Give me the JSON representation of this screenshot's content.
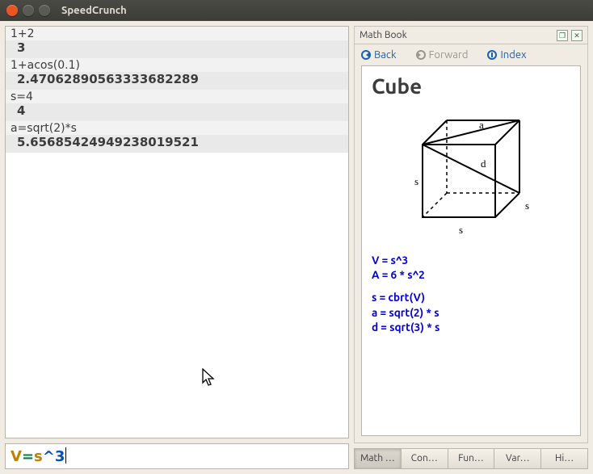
{
  "window": {
    "title": "SpeedCrunch"
  },
  "history": [
    {
      "expr": "1+2",
      "result": "3"
    },
    {
      "expr": "1+acos(0.1)",
      "result": "2.47062890563333682289"
    },
    {
      "expr": "s=4",
      "result": "4"
    },
    {
      "expr": "a=sqrt(2)*s",
      "result": "5.65685424949238019521"
    }
  ],
  "input": {
    "tokens": [
      {
        "t": "V",
        "cls": "sv-V"
      },
      {
        "t": "=",
        "cls": "sv-eq"
      },
      {
        "t": "s",
        "cls": "sv-s"
      },
      {
        "t": "^",
        "cls": "sv-caret"
      },
      {
        "t": "3",
        "cls": "sv-3"
      }
    ]
  },
  "mathbook": {
    "panel_title": "Math Book",
    "nav": {
      "back": "Back",
      "forward": "Forward",
      "index": "Index"
    },
    "page_title": "Cube",
    "diagram_labels": {
      "top": "a",
      "diag": "d",
      "side": "s"
    },
    "formulas_a": [
      "V = s^3",
      "A = 6 * s^2"
    ],
    "formulas_b": [
      "s = cbrt(V)",
      "a = sqrt(2) * s",
      "d = sqrt(3) * s"
    ]
  },
  "tabs": [
    {
      "label": "Math …",
      "active": true
    },
    {
      "label": "Con…",
      "active": false
    },
    {
      "label": "Fun…",
      "active": false
    },
    {
      "label": "Var…",
      "active": false
    },
    {
      "label": "Hi…",
      "active": false
    }
  ]
}
